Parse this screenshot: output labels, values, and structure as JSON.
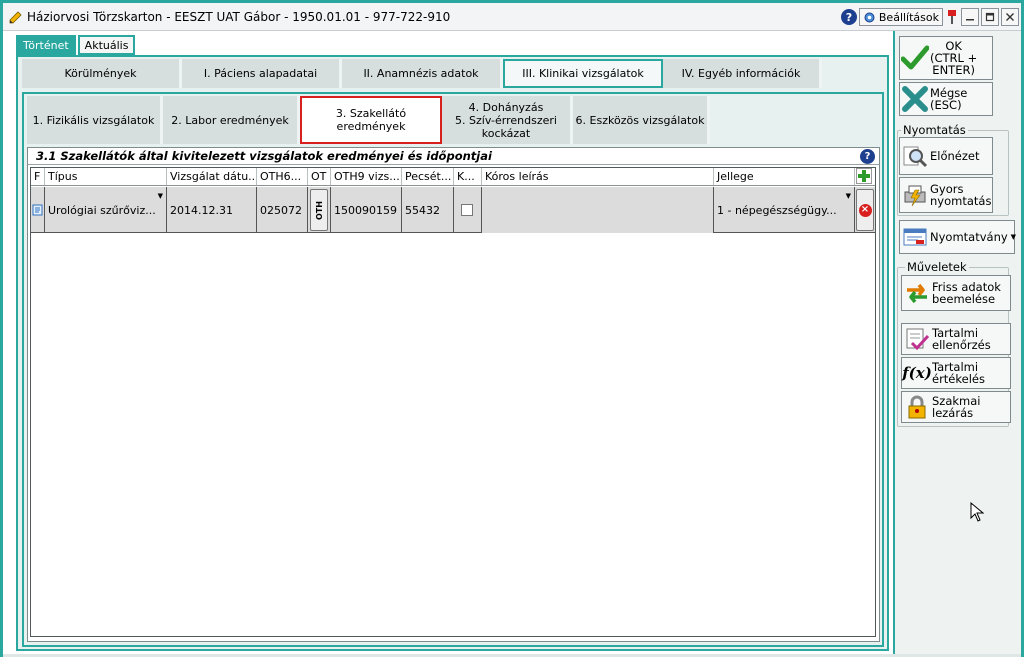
{
  "window": {
    "title": "Háziorvosi Törzskarton - EESZT UAT Gábor - 1950.01.01 - 977-722-910",
    "help_label": "?",
    "settings_label": "Beállítások"
  },
  "top_tabs": [
    {
      "label": "Történet",
      "active": true
    },
    {
      "label": "Aktuális",
      "active": false
    }
  ],
  "section_tabs": [
    {
      "label": "Körülmények",
      "active": false
    },
    {
      "label": "I. Páciens alapadatai",
      "active": false
    },
    {
      "label": "II. Anamnézis adatok",
      "active": false
    },
    {
      "label": "III. Klinikai vizsgálatok",
      "active": true
    },
    {
      "label": "IV. Egyéb információk",
      "active": false
    }
  ],
  "sub_tabs": [
    {
      "label": "1. Fizikális vizsgálatok",
      "active": false
    },
    {
      "label": "2. Labor eredmények",
      "active": false
    },
    {
      "label": "3. Szakellátó eredmények",
      "active": true
    },
    {
      "label_line1": "4. Dohányzás",
      "label_line2": "5. Szív-érrendszeri",
      "label_line3": "kockázat",
      "active": false
    },
    {
      "label": "6. Eszközös vizsgálatok",
      "active": false
    }
  ],
  "grid": {
    "title": "3.1 Szakellátók által kivitelezett vizsgálatok eredményei és időpontjai",
    "help_label": "?",
    "headers": [
      "F",
      "Típus",
      "Vizsgálat dátu...",
      "OTH6...",
      "OT",
      "OTH9 vizs...",
      "Pecsét...",
      "K...",
      "Kóros leírás",
      "Jellege"
    ],
    "rows": [
      {
        "tipus": "Urológiai szűrőviz...",
        "datum": "2014.12.31",
        "oth6": "025072",
        "ot_button": "OTH",
        "oth9": "150090159",
        "pecset": "55432",
        "koros_checked": false,
        "koros_leiras": "",
        "jellege": "1 - népegészségügy..."
      }
    ]
  },
  "right_panel": {
    "ok_line1": "OK",
    "ok_line2": "(CTRL +",
    "ok_line3": "ENTER)",
    "cancel_line1": "Mégse",
    "cancel_line2": "(ESC)",
    "print_group": "Nyomtatás",
    "preview": "Előnézet",
    "quick_print_line1": "Gyors",
    "quick_print_line2": "nyomtatás",
    "form": "Nyomtatvány",
    "ops_group": "Műveletek",
    "import_line1": "Friss adatok",
    "import_line2": "beemelése",
    "check_line1": "Tartalmi",
    "check_line2": "ellenőrzés",
    "eval_line1": "Tartalmi",
    "eval_line2": "értékelés",
    "close_line1": "Szakmai",
    "close_line2": "lezárás"
  },
  "colors": {
    "accent_teal": "#2aa8a0",
    "active_sub_tab_border": "#d8201e",
    "row_background": "#dcdcdc"
  }
}
